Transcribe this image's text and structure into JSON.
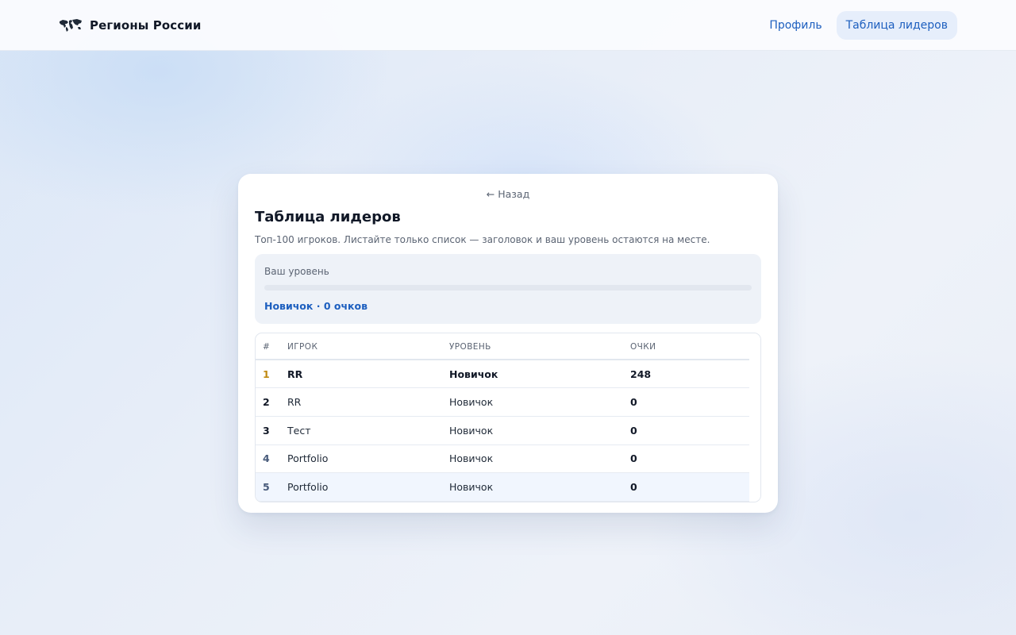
{
  "app": {
    "title": "Регионы России",
    "logo_icon": "world-map-icon"
  },
  "nav": {
    "items": [
      {
        "label": "Профиль",
        "active": false
      },
      {
        "label": "Таблица лидеров",
        "active": true
      }
    ]
  },
  "card": {
    "back_label": "← Назад",
    "title": "Таблица лидеров",
    "subtitle": "Топ-100 игроков. Листайте только список — заголовок и ваш уровень остаются на месте."
  },
  "level": {
    "label": "Ваш уровень",
    "progress": 0,
    "value": "Новичок · 0 очков"
  },
  "table": {
    "headers": {
      "rank": "#",
      "player": "ИГРОК",
      "level": "УРОВЕНЬ",
      "points": "ОЧКИ"
    },
    "rows": [
      {
        "rank": "1",
        "player": "RR",
        "level": "Новичок",
        "points": "248"
      },
      {
        "rank": "2",
        "player": "RR",
        "level": "Новичок",
        "points": "0"
      },
      {
        "rank": "3",
        "player": "Тест",
        "level": "Новичок",
        "points": "0"
      },
      {
        "rank": "4",
        "player": "Portfolio",
        "level": "Новичок",
        "points": "0"
      },
      {
        "rank": "5",
        "player": "Portfolio",
        "level": "Новичок",
        "points": "0"
      }
    ]
  },
  "colors": {
    "accent": "#1d5fbf",
    "rank_gold": "#c08a12",
    "rank_steel": "#475a7a",
    "rank_default": "#111827"
  }
}
